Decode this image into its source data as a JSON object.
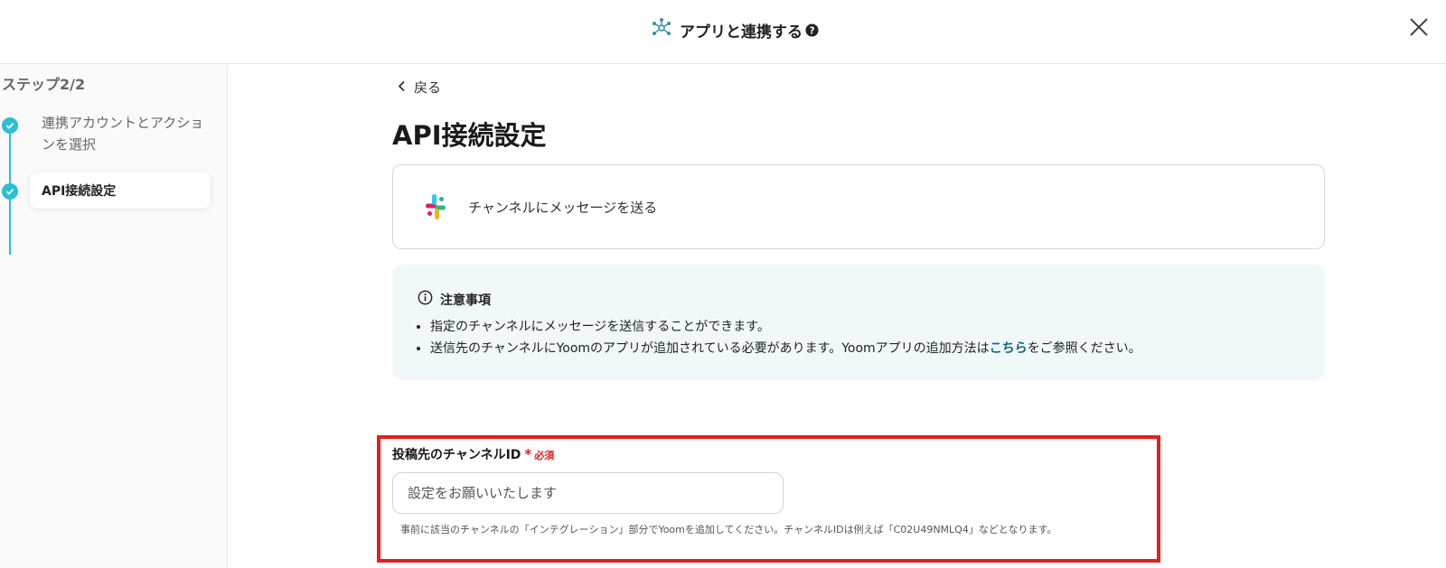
{
  "header": {
    "title": "アプリと連携する",
    "title_icon": "network-icon",
    "help_icon": "question-circle-icon",
    "close_icon": "close-icon"
  },
  "sidebar": {
    "step_count": "ステップ2/2",
    "steps": [
      {
        "label": "連携アカウントとアクションを選択",
        "status": "completed",
        "active": false
      },
      {
        "label": "API接続設定",
        "status": "completed",
        "active": true
      }
    ],
    "accent_color": "#2bbfd0"
  },
  "main": {
    "back_label": "戻る",
    "page_title": "API接続設定",
    "action": {
      "icon": "slack-icon",
      "label": "チャンネルにメッセージを送る"
    },
    "notice": {
      "icon": "info-circle-icon",
      "title": "注意事項",
      "items": [
        {
          "text": "指定のチャンネルにメッセージを送信することができます。"
        },
        {
          "text_before": "送信先のチャンネルにYoomのアプリが追加されている必要があります。Yoomアプリの追加方法は",
          "link": "こちら",
          "text_after": "をご参照ください。"
        }
      ]
    },
    "field": {
      "label": "投稿先のチャンネルID",
      "required_mark": "*",
      "required_text": "必須",
      "placeholder": "設定をお願いいたします",
      "value": "",
      "help": "事前に該当のチャンネルの「インテグレーション」部分でYoomを追加してください。チャンネルIDは例えば「C02U49NMLQ4」などとなります。"
    },
    "highlight_color": "#e02020"
  }
}
